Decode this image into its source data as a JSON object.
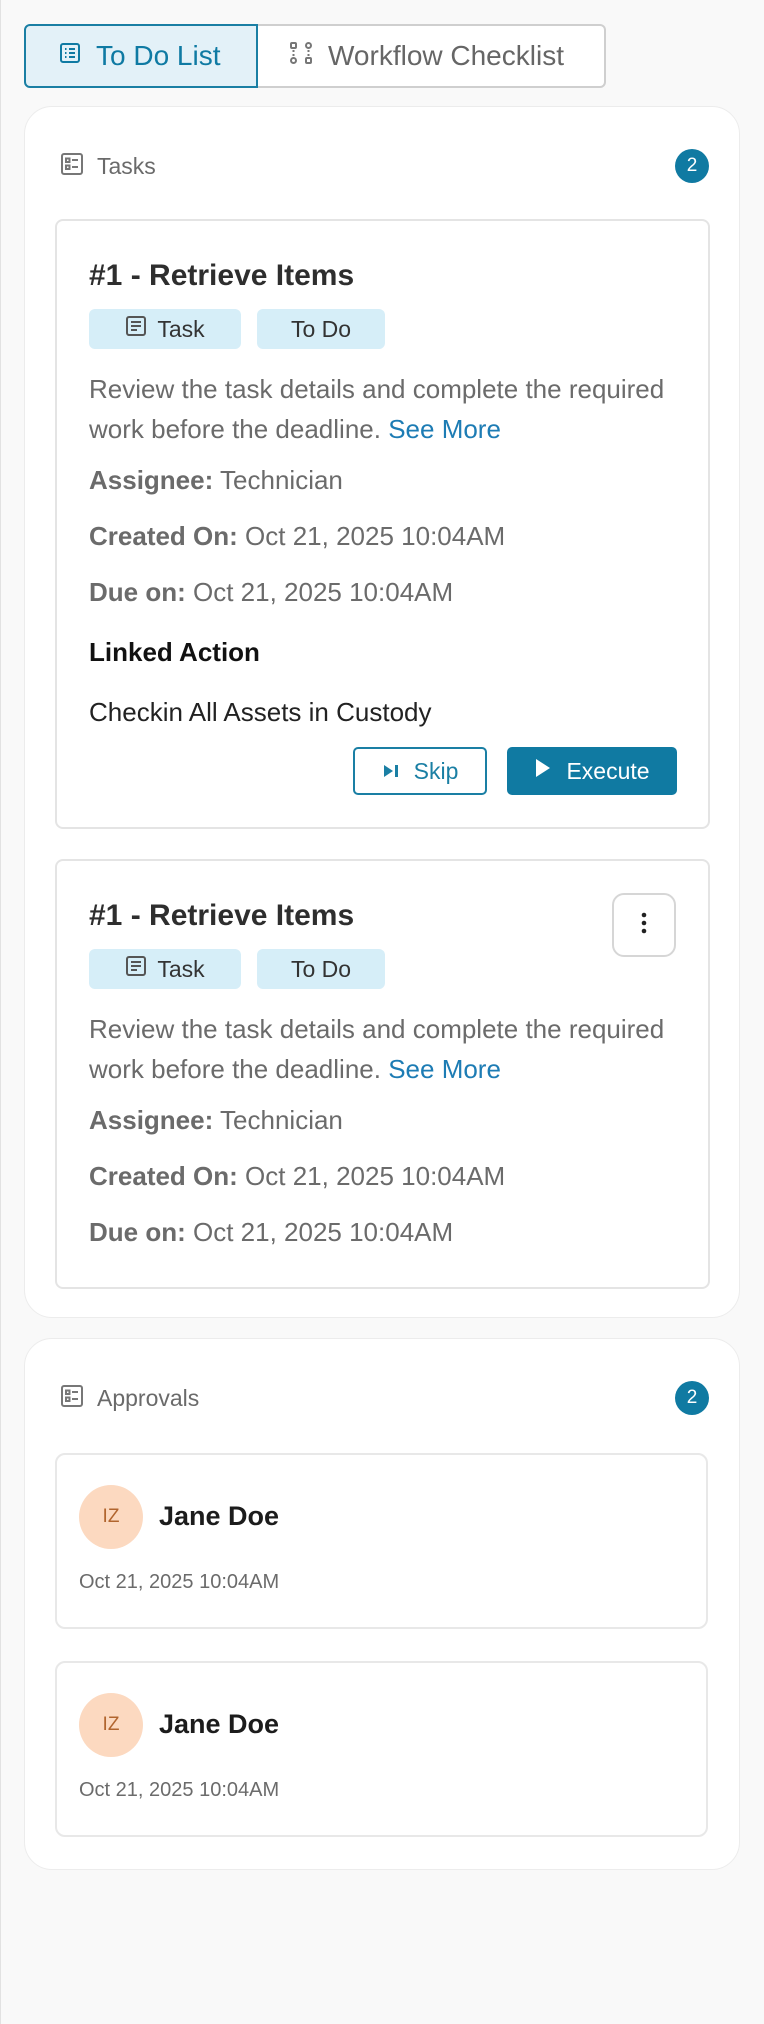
{
  "tabs": [
    {
      "label": "To Do List",
      "icon": "list-icon",
      "active": true
    },
    {
      "label": "Workflow Checklist",
      "icon": "workflow-icon",
      "active": false
    }
  ],
  "tasks_section": {
    "title": "Tasks",
    "count": "2",
    "cards": [
      {
        "title": "#1 - Retrieve Items",
        "type_chip": "Task",
        "status_chip": "To Do",
        "description": "Review the task details and complete the required work before the deadline.",
        "see_more": "See More",
        "assignee_label": "Assignee:",
        "assignee": "Technician",
        "created_label": "Created On:",
        "created": "Oct 21, 2025 10:04AM",
        "due_label": "Due on:",
        "due": "Oct 21, 2025 10:04AM",
        "linked_action_title": "Linked Action",
        "linked_action": "Checkin All Assets in Custody",
        "skip_label": "Skip",
        "execute_label": "Execute"
      },
      {
        "title": "#1 - Retrieve Items",
        "type_chip": "Task",
        "status_chip": "To Do",
        "description": "Review the task details and complete the required work before the deadline.",
        "see_more": "See More",
        "assignee_label": "Assignee:",
        "assignee": "Technician",
        "created_label": "Created On:",
        "created": "Oct 21, 2025 10:04AM",
        "due_label": "Due on:",
        "due": "Oct 21, 2025 10:04AM"
      }
    ]
  },
  "approvals_section": {
    "title": "Approvals",
    "count": "2",
    "items": [
      {
        "initials": "IZ",
        "name": "Jane Doe",
        "time": "Oct 21, 2025 10:04AM"
      },
      {
        "initials": "IZ",
        "name": "Jane Doe",
        "time": "Oct 21, 2025 10:04AM"
      }
    ]
  },
  "colors": {
    "accent": "#107aa2",
    "chip_bg": "#d6eef8",
    "avatar_bg": "#fcd9c0",
    "link": "#1d7cb4"
  }
}
